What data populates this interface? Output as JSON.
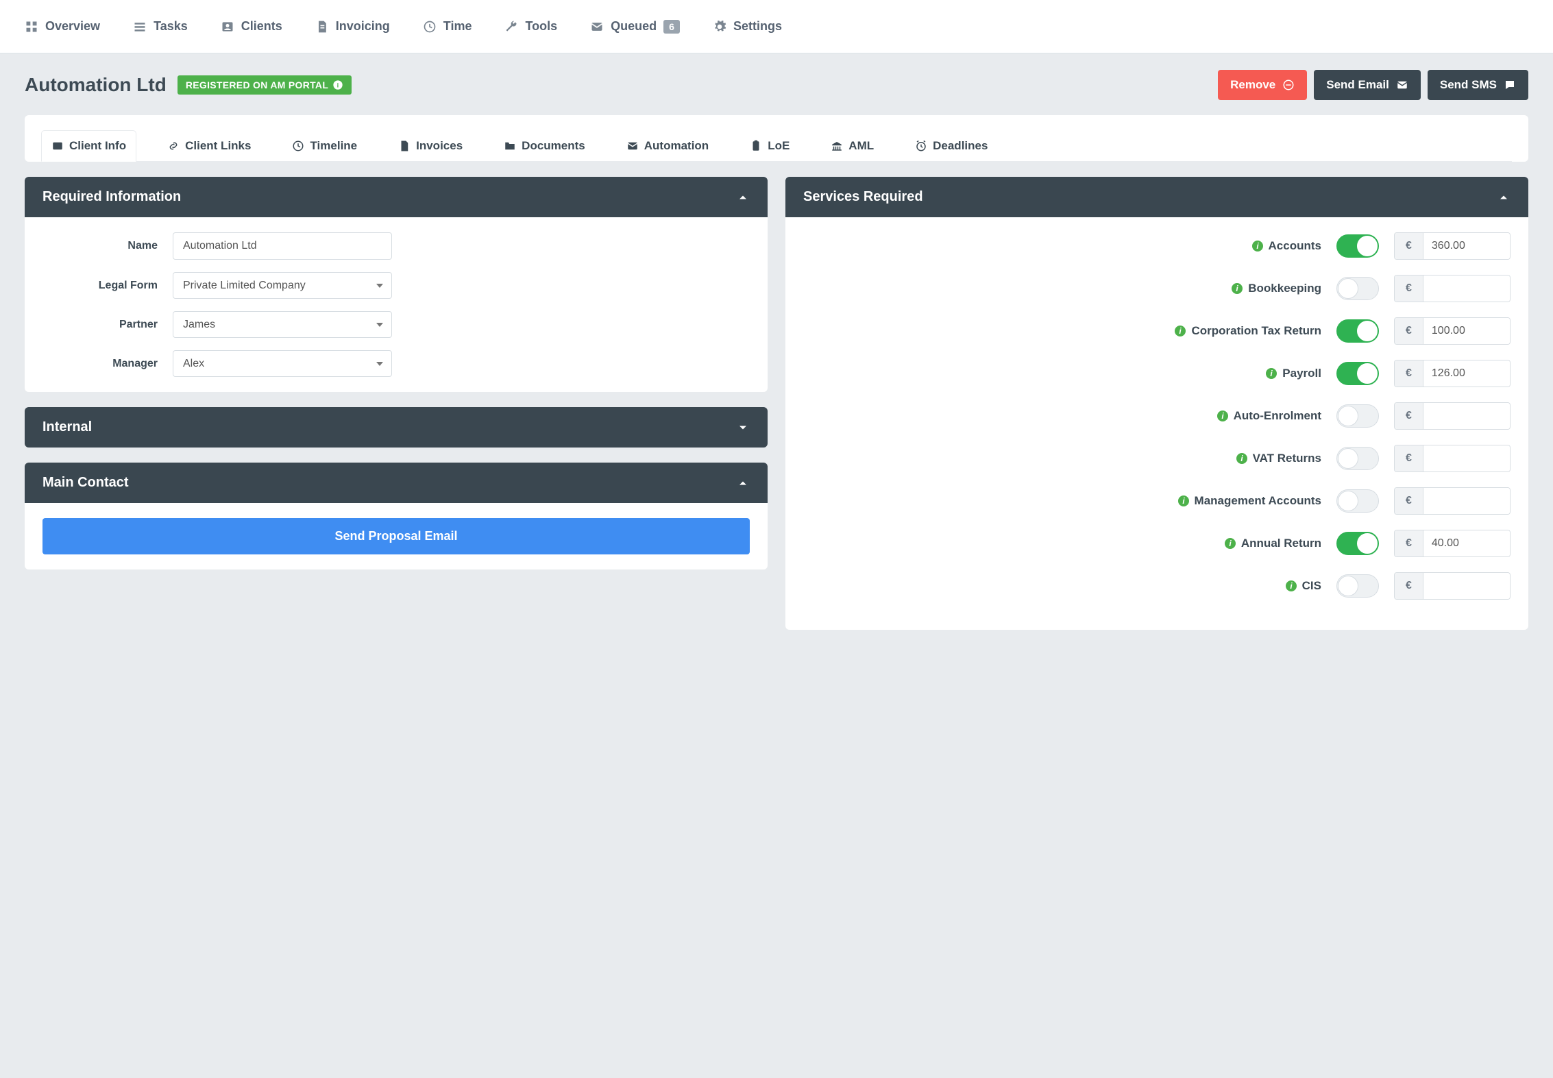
{
  "nav": {
    "overview": "Overview",
    "tasks": "Tasks",
    "clients": "Clients",
    "invoicing": "Invoicing",
    "time": "Time",
    "tools": "Tools",
    "queued": "Queued",
    "queued_count": "6",
    "settings": "Settings"
  },
  "header": {
    "title": "Automation Ltd",
    "badge": "REGISTERED ON AM PORTAL",
    "remove": "Remove",
    "send_email": "Send Email",
    "send_sms": "Send SMS"
  },
  "tabs": {
    "client_info": "Client Info",
    "client_links": "Client Links",
    "timeline": "Timeline",
    "invoices": "Invoices",
    "documents": "Documents",
    "automation": "Automation",
    "loe": "LoE",
    "aml": "AML",
    "deadlines": "Deadlines"
  },
  "panels": {
    "required_info": "Required Information",
    "internal": "Internal",
    "main_contact": "Main Contact",
    "services_required": "Services Required"
  },
  "form": {
    "name_label": "Name",
    "name_value": "Automation Ltd",
    "legal_form_label": "Legal Form",
    "legal_form_value": "Private Limited Company",
    "partner_label": "Partner",
    "partner_value": "James",
    "manager_label": "Manager",
    "manager_value": "Alex"
  },
  "proposal_button": "Send Proposal Email",
  "currency": "€",
  "services": [
    {
      "label": "Accounts",
      "on": true,
      "price": "360.00"
    },
    {
      "label": "Bookkeeping",
      "on": false,
      "price": ""
    },
    {
      "label": "Corporation Tax Return",
      "on": true,
      "price": "100.00"
    },
    {
      "label": "Payroll",
      "on": true,
      "price": "126.00"
    },
    {
      "label": "Auto-Enrolment",
      "on": false,
      "price": ""
    },
    {
      "label": "VAT Returns",
      "on": false,
      "price": ""
    },
    {
      "label": "Management Accounts",
      "on": false,
      "price": ""
    },
    {
      "label": "Annual Return",
      "on": true,
      "price": "40.00"
    },
    {
      "label": "CIS",
      "on": false,
      "price": ""
    }
  ]
}
